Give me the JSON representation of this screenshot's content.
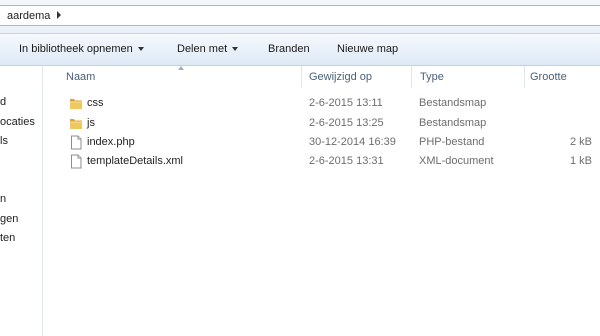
{
  "address": {
    "breadcrumb": "aardema"
  },
  "toolbar": {
    "library_label": "In bibliotheek opnemen",
    "share_label": "Delen met",
    "burn_label": "Branden",
    "new_folder_label": "Nieuwe map"
  },
  "nav": {
    "items": [
      "d",
      "ocaties",
      "ls",
      "n",
      "gen",
      "ten"
    ]
  },
  "columns": {
    "name": "Naam",
    "modified": "Gewijzigd op",
    "type": "Type",
    "size": "Grootte"
  },
  "files": [
    {
      "name": "css",
      "modified": "2-6-2015 13:11",
      "type": "Bestandsmap",
      "size": "",
      "icon": "folder-icon"
    },
    {
      "name": "js",
      "modified": "2-6-2015 13:25",
      "type": "Bestandsmap",
      "size": "",
      "icon": "folder-icon"
    },
    {
      "name": "index.php",
      "modified": "30-12-2014 16:39",
      "type": "PHP-bestand",
      "size": "2 kB",
      "icon": "file-icon"
    },
    {
      "name": "templateDetails.xml",
      "modified": "2-6-2015 13:31",
      "type": "XML-document",
      "size": "1 kB",
      "icon": "file-icon"
    }
  ],
  "colors": {
    "toolbar_bg": "#dde8f5",
    "folder": "#e8b84a",
    "header_text": "#4c607a"
  }
}
